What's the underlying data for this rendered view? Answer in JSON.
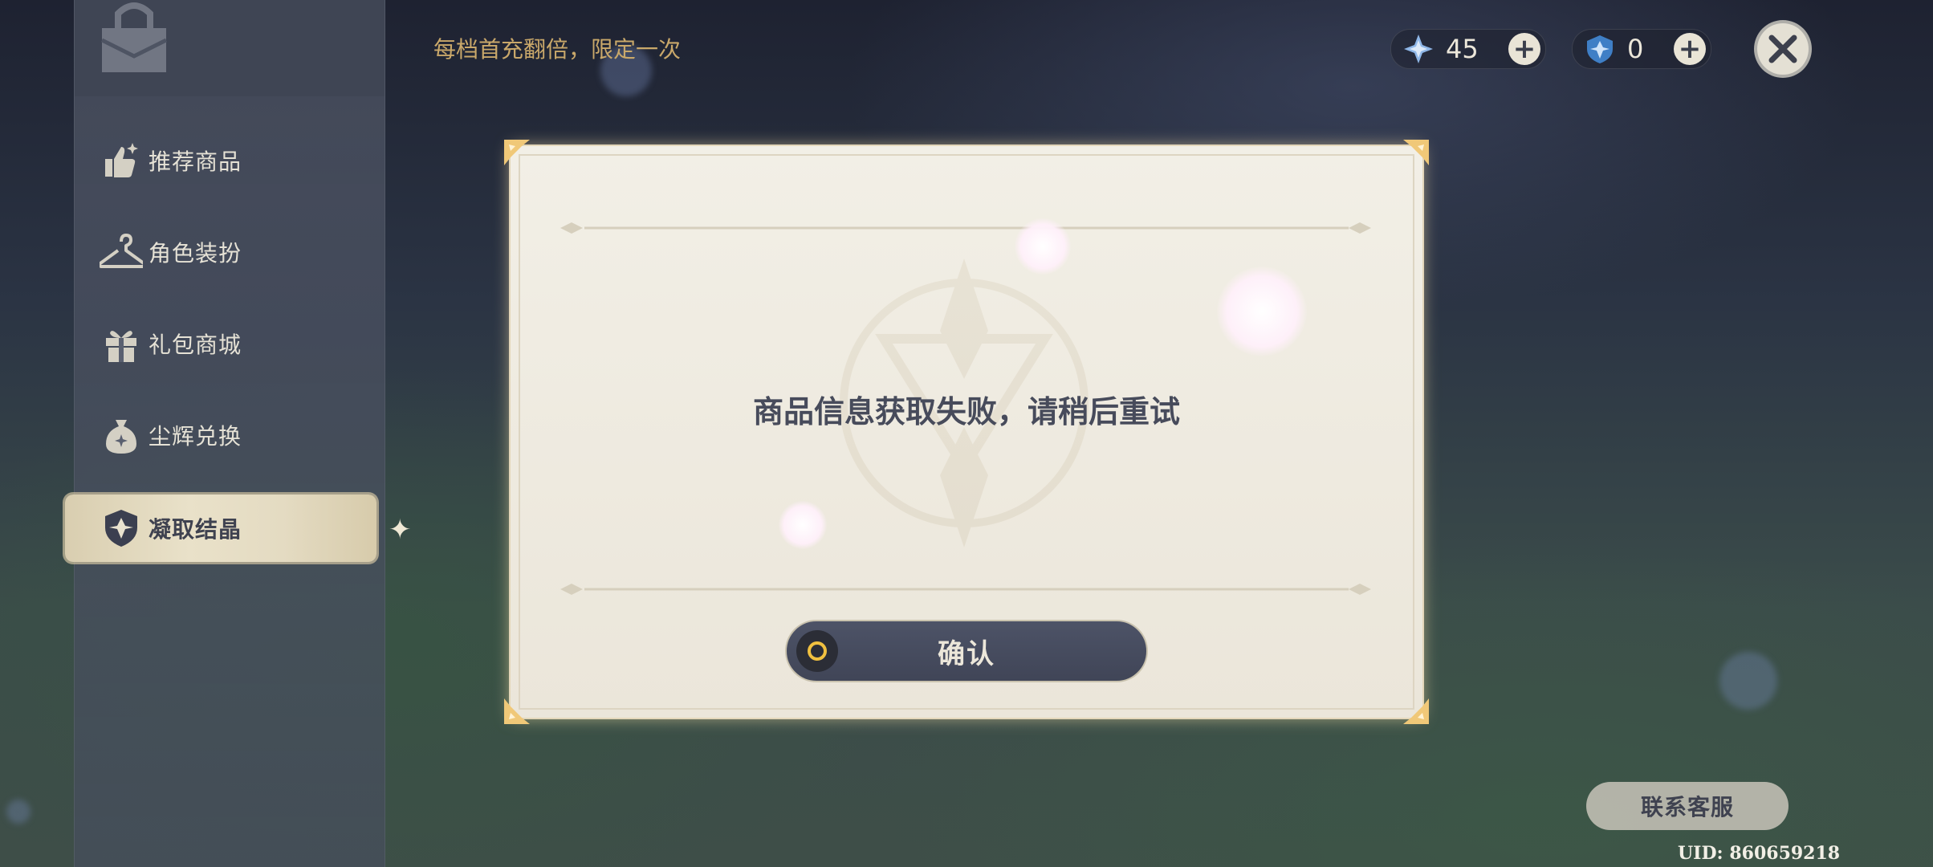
{
  "top_bar": {
    "promo_text": "每档首充翻倍，限定一次",
    "primogems": {
      "icon": "primogem-star-icon",
      "value": "45"
    },
    "genesis_crystals": {
      "icon": "genesis-crystal-icon",
      "value": "0"
    },
    "add_icon": "plus-icon",
    "close_icon": "close-x-icon"
  },
  "sidebar": {
    "logo_icon": "shop-bag-icon",
    "items": [
      {
        "label": "推荐商品",
        "icon": "thumbs-up-sparkle-icon",
        "active": false
      },
      {
        "label": "角色装扮",
        "icon": "hanger-icon",
        "active": false
      },
      {
        "label": "礼包商城",
        "icon": "gift-box-icon",
        "active": false
      },
      {
        "label": "尘辉兑换",
        "icon": "coin-pouch-icon",
        "active": false
      },
      {
        "label": "凝取结晶",
        "icon": "crystal-emblem-icon",
        "active": true
      }
    ]
  },
  "dialog": {
    "message": "商品信息获取失败，请稍后重试",
    "confirm_label": "确认",
    "confirm_key_icon": "gamepad-circle-button-icon"
  },
  "footer": {
    "support_label": "联系客服",
    "uid_text": "UID: 860659218"
  },
  "colors": {
    "accent_gold": "#c9a86a",
    "dialog_bg": "#f2efe6",
    "button_dark": "#474c5f"
  }
}
